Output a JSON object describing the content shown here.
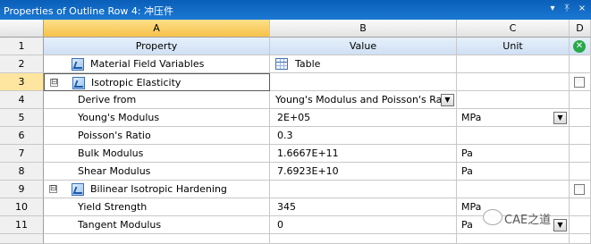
{
  "window": {
    "title": "Properties of Outline Row 4: 冲压件",
    "controls": [
      "▾",
      "ᛡ",
      "×"
    ]
  },
  "columns": {
    "letters": [
      "A",
      "B",
      "C",
      "D"
    ],
    "headers": [
      "Property",
      "Value",
      "Unit"
    ]
  },
  "rows": [
    {
      "num": "1"
    },
    {
      "num": "2",
      "property": "Material Field Variables",
      "value": "Table"
    },
    {
      "num": "3",
      "property": "Isotropic Elasticity",
      "expander": "⊟"
    },
    {
      "num": "4",
      "property": "Derive from",
      "value": "Young's Modulus and Poisson's Ratio"
    },
    {
      "num": "5",
      "property": "Young's Modulus",
      "value": "2E+05",
      "unit": "MPa"
    },
    {
      "num": "6",
      "property": "Poisson's Ratio",
      "value": "0.3"
    },
    {
      "num": "7",
      "property": "Bulk Modulus",
      "value": "1.6667E+11",
      "unit": "Pa"
    },
    {
      "num": "8",
      "property": "Shear Modulus",
      "value": "7.6923E+10",
      "unit": "Pa"
    },
    {
      "num": "9",
      "property": "Bilinear Isotropic Hardening",
      "expander": "⊟"
    },
    {
      "num": "10",
      "property": "Yield Strength",
      "value": "345",
      "unit": "MPa"
    },
    {
      "num": "11",
      "property": "Tangent Modulus",
      "value": "0",
      "unit": "Pa"
    }
  ],
  "watermark": {
    "text": "CAE之道"
  },
  "colors": {
    "titlebar": "#0a5fb8",
    "selected_col": "#f6c24a",
    "header_row": "#cfe0f4"
  }
}
